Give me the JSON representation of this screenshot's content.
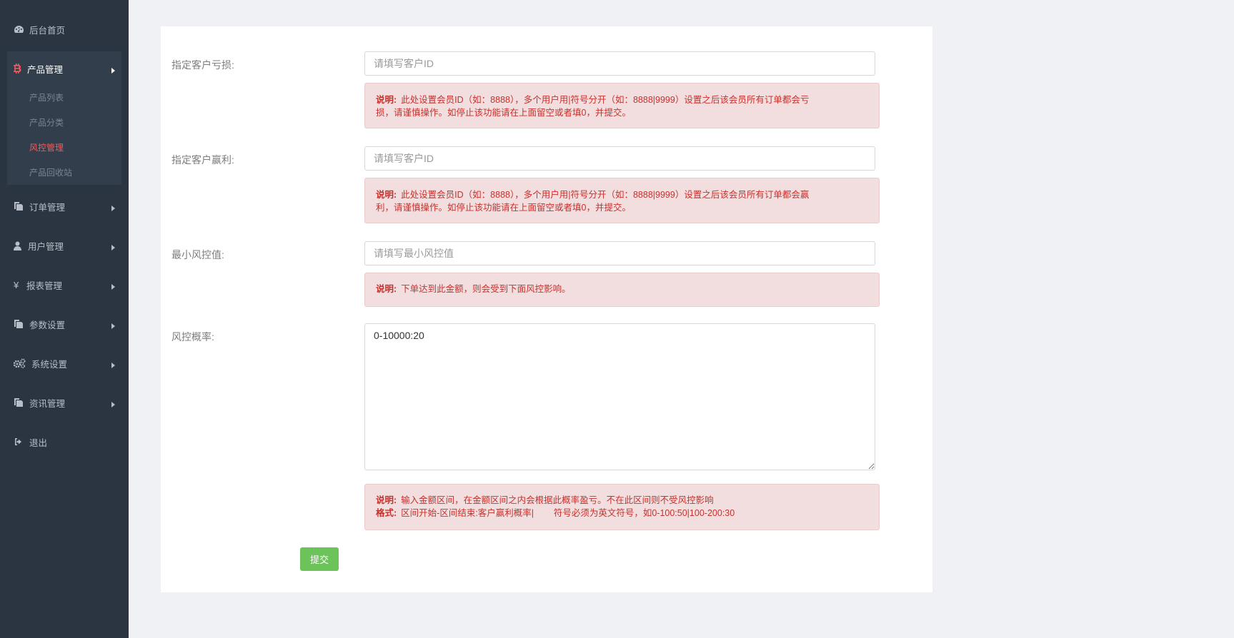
{
  "sidebar": {
    "items": [
      {
        "label": "后台首页",
        "icon": "dashboard-icon"
      },
      {
        "label": "产品管理",
        "icon": "bitcoin-icon"
      },
      {
        "label": "订单管理",
        "icon": "copy-icon"
      },
      {
        "label": "用户管理",
        "icon": "user-icon"
      },
      {
        "label": "报表管理",
        "icon": "yen-icon"
      },
      {
        "label": "参数设置",
        "icon": "copy-icon"
      },
      {
        "label": "系统设置",
        "icon": "gears-icon"
      },
      {
        "label": "资讯管理",
        "icon": "copy-icon"
      },
      {
        "label": "退出",
        "icon": "sign-out-icon"
      }
    ],
    "submenu": [
      {
        "label": "产品列表"
      },
      {
        "label": "产品分类"
      },
      {
        "label": "风控管理"
      },
      {
        "label": "产品回收站"
      }
    ],
    "active_color": "#ef5d5d"
  },
  "form": {
    "loss": {
      "label": "指定客户亏损:",
      "placeholder": "请填写客户ID",
      "note_title": "说明:",
      "note_text": "此处设置会员ID（如：8888），多个用户用|符号分开（如：8888|9999）设置之后该会员所有订单都会亏",
      "note_text2": "损，请谨慎操作。如停止该功能请在上面留空或者填0，并提交。"
    },
    "win": {
      "label": "指定客户赢利:",
      "placeholder": "请填写客户ID",
      "note_title": "说明:",
      "note_text": "此处设置会员ID（如：8888），多个用户用|符号分开（如：8888|9999）设置之后该会员所有订单都会赢",
      "note_text2": "利，请谨慎操作。如停止该功能请在上面留空或者填0，并提交。"
    },
    "min_risk": {
      "label": "最小风控值:",
      "placeholder": "请填写最小风控值",
      "note_title": "说明:",
      "note_text": "下单达到此金额，则会受到下面风控影响。"
    },
    "probability": {
      "label": "风控概率:",
      "value": "0-10000:20",
      "note_title": "说明:",
      "note_text": "输入金额区间，在金额区间之内会根据此概率盈亏。不在此区间则不受风控影响",
      "format_title": "格式:",
      "format_text": "区间开始-区间结束:客户赢利概率|        符号必须为英文符号，如0-100:50|100-200:30"
    },
    "submit_label": "提交"
  }
}
